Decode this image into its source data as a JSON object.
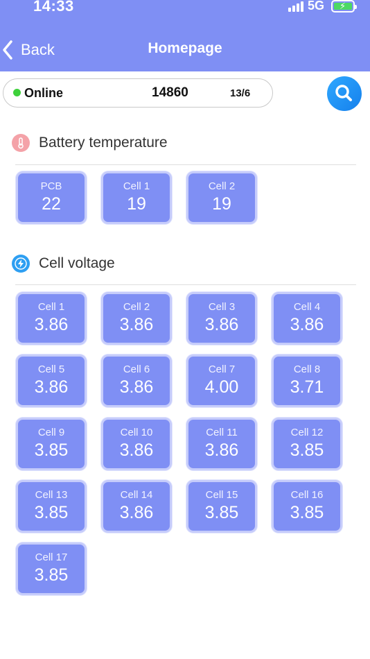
{
  "status_bar": {
    "time": "14:33",
    "network": "5G"
  },
  "nav": {
    "back_label": "Back",
    "title": "Homepage"
  },
  "info_bar": {
    "status": "Online",
    "device_id": "14860",
    "date": "13/6"
  },
  "battery_temperature": {
    "title": "Battery temperature",
    "tiles": [
      {
        "label": "PCB",
        "value": "22"
      },
      {
        "label": "Cell 1",
        "value": "19"
      },
      {
        "label": "Cell 2",
        "value": "19"
      }
    ]
  },
  "cell_voltage": {
    "title": "Cell voltage",
    "tiles": [
      {
        "label": "Cell 1",
        "value": "3.86"
      },
      {
        "label": "Cell 2",
        "value": "3.86"
      },
      {
        "label": "Cell 3",
        "value": "3.86"
      },
      {
        "label": "Cell 4",
        "value": "3.86"
      },
      {
        "label": "Cell 5",
        "value": "3.86"
      },
      {
        "label": "Cell 6",
        "value": "3.86"
      },
      {
        "label": "Cell 7",
        "value": "4.00"
      },
      {
        "label": "Cell 8",
        "value": "3.71"
      },
      {
        "label": "Cell 9",
        "value": "3.85"
      },
      {
        "label": "Cell 10",
        "value": "3.86"
      },
      {
        "label": "Cell 11",
        "value": "3.86"
      },
      {
        "label": "Cell 12",
        "value": "3.85"
      },
      {
        "label": "Cell 13",
        "value": "3.85"
      },
      {
        "label": "Cell 14",
        "value": "3.86"
      },
      {
        "label": "Cell 15",
        "value": "3.85"
      },
      {
        "label": "Cell 16",
        "value": "3.85"
      },
      {
        "label": "Cell 17",
        "value": "3.85"
      }
    ]
  },
  "icons": {
    "back": "chevron-left-icon",
    "search": "search-icon",
    "temperature": "thermometer-icon",
    "voltage": "lightning-icon"
  },
  "colors": {
    "header": "#7f8ff4",
    "tile": "#7f8ff4",
    "online": "#3ed13b",
    "search": "#1a8cf0"
  }
}
